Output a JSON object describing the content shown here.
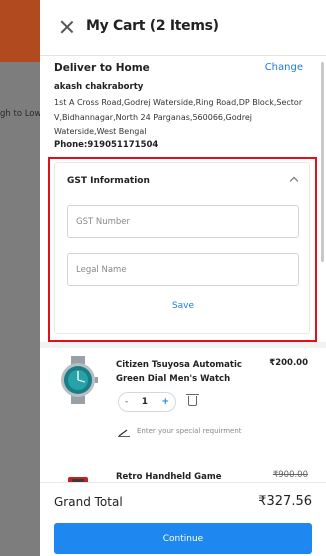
{
  "background": {
    "sort_text": "gh to Low"
  },
  "header": {
    "title": "My Cart (2 Items)"
  },
  "delivery": {
    "title": "Deliver to Home",
    "change_label": "Change",
    "name": "akash chakraborty",
    "address": "1st A Cross Road,Godrej Waterside,Ring Road,DP Block,Sector V,Bidhannagar,North 24 Parganas,560066,Godrej Waterside,West Bengal",
    "phone": "Phone:919051171504"
  },
  "gst": {
    "title": "GST Information",
    "gst_number_placeholder": "GST Number",
    "legal_name_placeholder": "Legal Name",
    "save_label": "Save"
  },
  "items": [
    {
      "name": "Citizen Tsuyosa Automatic Green Dial Men's Watch",
      "price": "₹200.00",
      "quantity": "1",
      "minus": "-",
      "plus": "+",
      "requirement_placeholder": "Enter your special requirment"
    },
    {
      "name": "Retro Handheld Game Console",
      "price": "₹900.00"
    }
  ],
  "footer": {
    "grand_total_label": "Grand Total",
    "grand_total_value": "₹327.56",
    "continue_label": "Continue"
  },
  "colors": {
    "accent": "#1e88f0",
    "link": "#1e7be0",
    "highlight": "#e0101a"
  }
}
